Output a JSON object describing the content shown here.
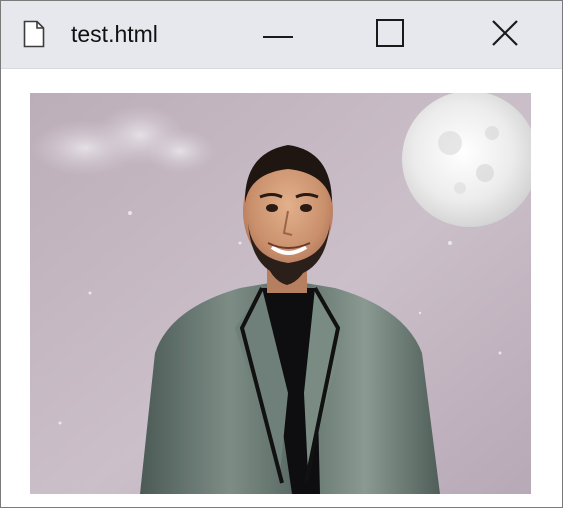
{
  "window": {
    "title": "test.html",
    "controls": {
      "minimize_icon": "minimize-icon",
      "maximize_icon": "maximize-icon",
      "close_icon": "close-icon"
    }
  },
  "content": {
    "image_icon": "portrait-photo"
  },
  "colors": {
    "titlebar": "#e6e8ed",
    "window_border": "#7a7a7a",
    "background": "#ffffff",
    "sky": "#c9bcc6",
    "jacket": "#5e6f68",
    "shirt": "#0e0e10"
  }
}
